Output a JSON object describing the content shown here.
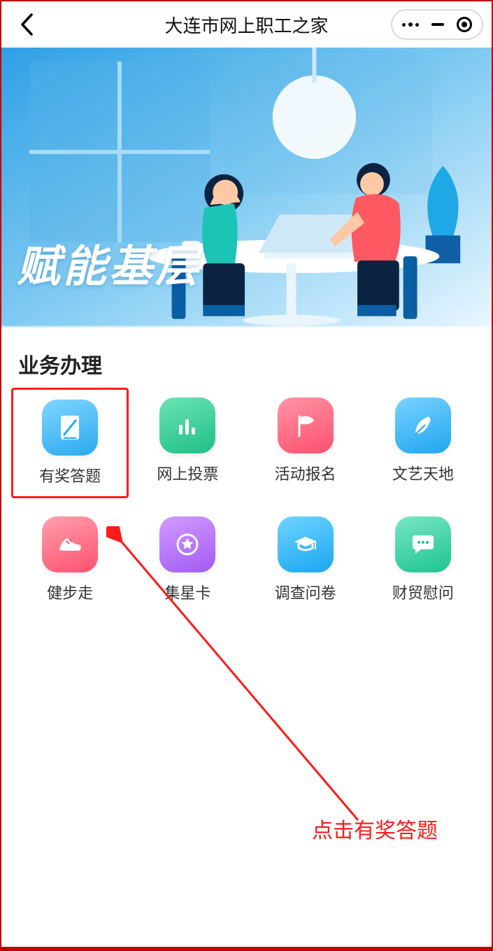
{
  "header": {
    "title": "大连市网上职工之家"
  },
  "banner": {
    "headline": "赋能基层"
  },
  "section": {
    "title": "业务办理",
    "tiles": [
      {
        "label": "有奖答题"
      },
      {
        "label": "网上投票"
      },
      {
        "label": "活动报名"
      },
      {
        "label": "文艺天地"
      },
      {
        "label": "健步走"
      },
      {
        "label": "集星卡"
      },
      {
        "label": "调查问卷"
      },
      {
        "label": "财贸慰问"
      }
    ]
  },
  "annotation": {
    "text": "点击有奖答题"
  }
}
